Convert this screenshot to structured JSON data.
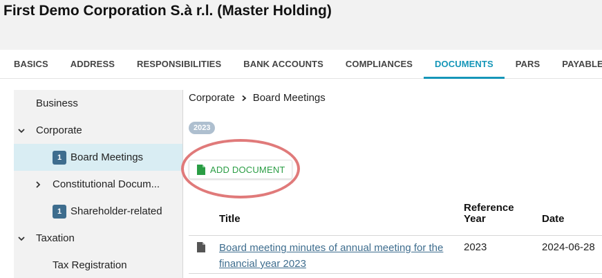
{
  "page": {
    "title": "First Demo Corporation S.à r.l. (Master Holding)"
  },
  "tabs": [
    {
      "label": "BASICS",
      "active": false
    },
    {
      "label": "ADDRESS",
      "active": false
    },
    {
      "label": "RESPONSIBILITIES",
      "active": false
    },
    {
      "label": "BANK ACCOUNTS",
      "active": false
    },
    {
      "label": "COMPLIANCES",
      "active": false
    },
    {
      "label": "DOCUMENTS",
      "active": true
    },
    {
      "label": "PARS",
      "active": false
    },
    {
      "label": "PAYABLES",
      "active": false
    }
  ],
  "sidebar": {
    "items": [
      {
        "label": "Business",
        "level": 0,
        "expander": "none"
      },
      {
        "label": "Corporate",
        "level": 0,
        "expander": "expanded"
      },
      {
        "label": "Board Meetings",
        "level": 1,
        "badge": "1",
        "selected": true
      },
      {
        "label": "Constitutional Docum...",
        "level": 1,
        "expander": "collapsed"
      },
      {
        "label": "Shareholder-related",
        "level": 1,
        "badge": "1"
      },
      {
        "label": "Taxation",
        "level": 0,
        "expander": "expanded"
      },
      {
        "label": "Tax Registration",
        "level": 1
      }
    ]
  },
  "breadcrumb": {
    "items": [
      "Corporate",
      "Board Meetings"
    ]
  },
  "year_filter": {
    "label": "2023"
  },
  "toolbar": {
    "add_document_label": "ADD DOCUMENT"
  },
  "table": {
    "headers": {
      "title": "Title",
      "reference_year_line1": "Reference",
      "reference_year_line2": "Year",
      "date": "Date"
    },
    "rows": [
      {
        "title": "Board meeting minutes of annual meeting for the financial year 2023",
        "reference_year": "2023",
        "date": "2024-06-28"
      }
    ]
  },
  "colors": {
    "accent": "#1596b8",
    "badge": "#3e6d8e",
    "link": "#3e6d8e",
    "add_button_text": "#2a9d44",
    "highlight_ring": "#e07a7a",
    "selected_row": "#d9edf3"
  },
  "icons": {
    "add_document": "file-add-icon",
    "row_file": "file-icon",
    "breadcrumb_separator": "chevron-right-icon",
    "expanded": "chevron-down-icon",
    "collapsed": "chevron-right-icon"
  }
}
